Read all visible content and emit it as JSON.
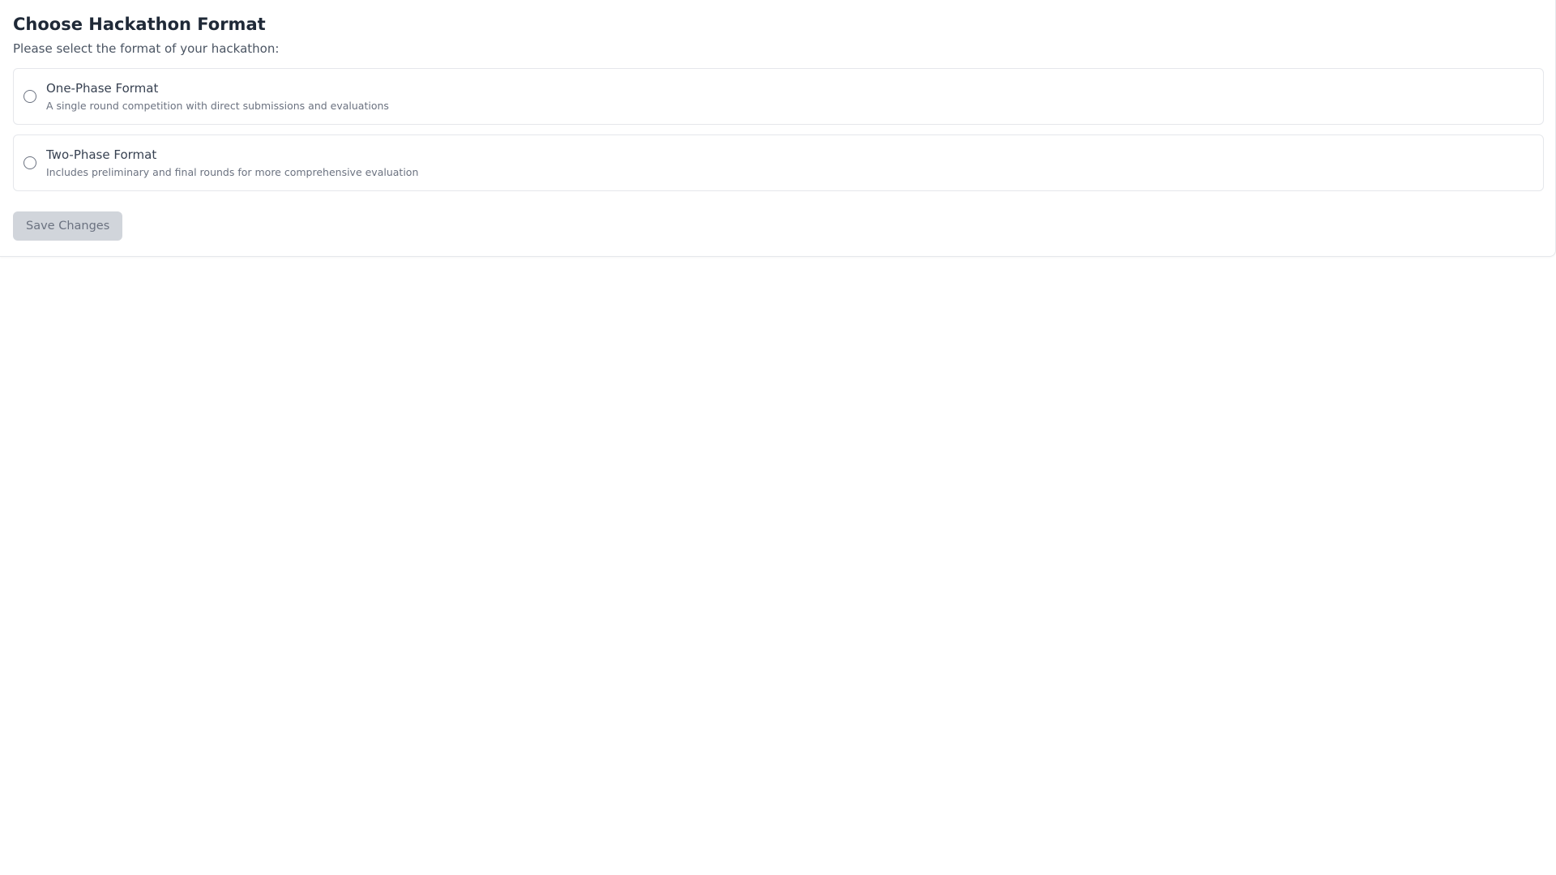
{
  "header": {
    "title": "Choose Hackathon Format",
    "subtitle": "Please select the format of your hackathon:"
  },
  "options": [
    {
      "label": "One-Phase Format",
      "description": "A single round competition with direct submissions and evaluations",
      "selected": false
    },
    {
      "label": "Two-Phase Format",
      "description": "Includes preliminary and final rounds for more comprehensive evaluation",
      "selected": false
    }
  ],
  "actions": {
    "save_label": "Save Changes",
    "save_disabled": true
  },
  "colors": {
    "border": "#e5e7eb",
    "title": "#1f2937",
    "muted_text": "#6b7280",
    "disabled_button_bg": "#d1d5db"
  }
}
